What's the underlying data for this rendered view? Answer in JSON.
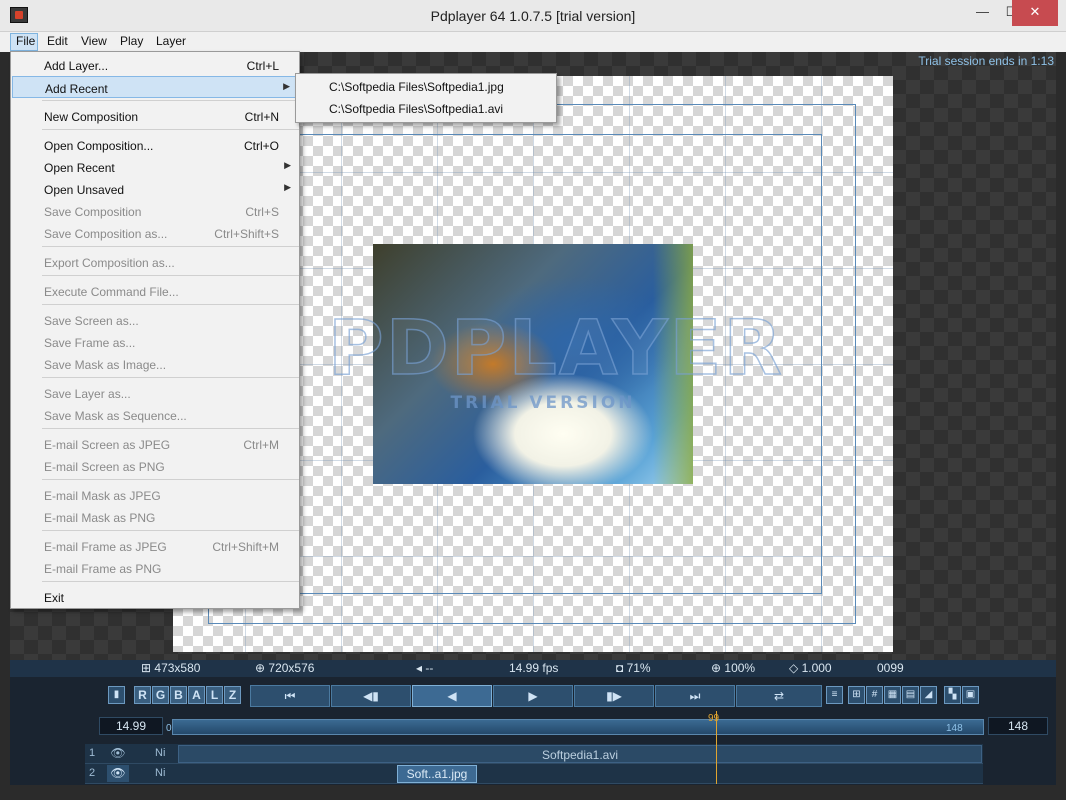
{
  "window": {
    "title": "Pdplayer 64 1.0.7.5 [trial version]",
    "minimize": "—",
    "maximize": "☐",
    "close": "✕"
  },
  "menubar": [
    "File",
    "Edit",
    "View",
    "Play",
    "Layer"
  ],
  "file_menu": [
    {
      "label": "Add Layer...",
      "shortcut": "Ctrl+L",
      "enabled": true
    },
    {
      "label": "Add Recent",
      "shortcut": "",
      "enabled": true,
      "submenu": true,
      "highlighted": true
    },
    {
      "label": "New Composition",
      "shortcut": "Ctrl+N",
      "enabled": true
    },
    {
      "label": "Open Composition...",
      "shortcut": "Ctrl+O",
      "enabled": true
    },
    {
      "label": "Open Recent",
      "shortcut": "",
      "enabled": true,
      "submenu": true
    },
    {
      "label": "Open Unsaved",
      "shortcut": "",
      "enabled": true,
      "submenu": true
    },
    {
      "label": "Save Composition",
      "shortcut": "Ctrl+S",
      "enabled": false
    },
    {
      "label": "Save Composition as...",
      "shortcut": "Ctrl+Shift+S",
      "enabled": false
    },
    {
      "label": "Export Composition as...",
      "shortcut": "",
      "enabled": false
    },
    {
      "label": "Execute Command File...",
      "shortcut": "",
      "enabled": false
    },
    {
      "label": "Save Screen as...",
      "shortcut": "",
      "enabled": false
    },
    {
      "label": "Save Frame as...",
      "shortcut": "",
      "enabled": false
    },
    {
      "label": "Save Mask as Image...",
      "shortcut": "",
      "enabled": false
    },
    {
      "label": "Save Layer as...",
      "shortcut": "",
      "enabled": false
    },
    {
      "label": "Save Mask as Sequence...",
      "shortcut": "",
      "enabled": false
    },
    {
      "label": "E-mail Screen as JPEG",
      "shortcut": "Ctrl+M",
      "enabled": false
    },
    {
      "label": "E-mail Screen as PNG",
      "shortcut": "",
      "enabled": false
    },
    {
      "label": "E-mail Mask as JPEG",
      "shortcut": "",
      "enabled": false
    },
    {
      "label": "E-mail Mask as PNG",
      "shortcut": "",
      "enabled": false
    },
    {
      "label": "E-mail Frame as JPEG",
      "shortcut": "Ctrl+Shift+M",
      "enabled": false
    },
    {
      "label": "E-mail Frame as PNG",
      "shortcut": "",
      "enabled": false
    },
    {
      "label": "Exit",
      "shortcut": "",
      "enabled": true
    }
  ],
  "add_recent_submenu": [
    "C:\\Softpedia Files\\Softpedia1.jpg",
    "C:\\Softpedia Files\\Softpedia1.avi"
  ],
  "viewer": {
    "trial_note": "Trial session ends in 1:13",
    "watermark": "PDPLAYER",
    "watermark_sub": "TRIAL VERSION"
  },
  "infobar": {
    "layer_size": "⊞ 473x580",
    "comp_size": "⊕ 720x576",
    "audio": "◂ --",
    "fps": "14.99 fps",
    "opacity": "◘ 71%",
    "zoom": "⊕ 100%",
    "aspect": "◇ 1.000",
    "frame": "0099"
  },
  "controls": {
    "channels": [
      "R",
      "G",
      "B",
      "A",
      "L",
      "Z"
    ],
    "transport": [
      "⏮",
      "◀▮",
      "◀",
      "▶",
      "▮▶",
      "⏭",
      "⇄"
    ]
  },
  "timeline": {
    "fps_value": "14.99",
    "start": "0",
    "end": "148",
    "current": "99",
    "end_box": "148"
  },
  "layers": [
    {
      "num": "1",
      "ni": "Ni",
      "name": "Softpedia1.avi"
    },
    {
      "num": "2",
      "ni": "Ni",
      "name": "Soft..a1.jpg"
    }
  ],
  "colors": {
    "accent": "#86b8e6",
    "playhead": "#e0a530"
  }
}
